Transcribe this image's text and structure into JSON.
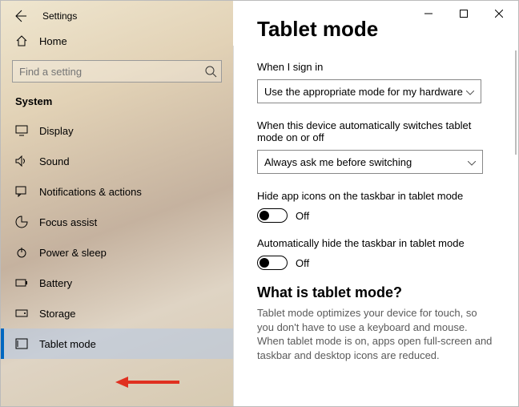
{
  "window": {
    "title": "Settings"
  },
  "sidebar": {
    "home_label": "Home",
    "search_placeholder": "Find a setting",
    "section_heading": "System",
    "items": [
      {
        "label": "Display"
      },
      {
        "label": "Sound"
      },
      {
        "label": "Notifications & actions"
      },
      {
        "label": "Focus assist"
      },
      {
        "label": "Power & sleep"
      },
      {
        "label": "Battery"
      },
      {
        "label": "Storage"
      },
      {
        "label": "Tablet mode"
      }
    ],
    "selected_index": 7
  },
  "main": {
    "heading": "Tablet mode",
    "signin_label": "When I sign in",
    "signin_value": "Use the appropriate mode for my hardware",
    "autoswitch_label": "When this device automatically switches tablet mode on or off",
    "autoswitch_value": "Always ask me before switching",
    "toggle1_label": "Hide app icons on the taskbar in tablet mode",
    "toggle1_value": "Off",
    "toggle2_label": "Automatically hide the taskbar in tablet mode",
    "toggle2_value": "Off",
    "about_heading": "What is tablet mode?",
    "about_text": "Tablet mode optimizes your device for touch, so you don't have to use a keyboard and mouse. When tablet mode is on, apps open full-screen and taskbar and desktop icons are reduced."
  }
}
